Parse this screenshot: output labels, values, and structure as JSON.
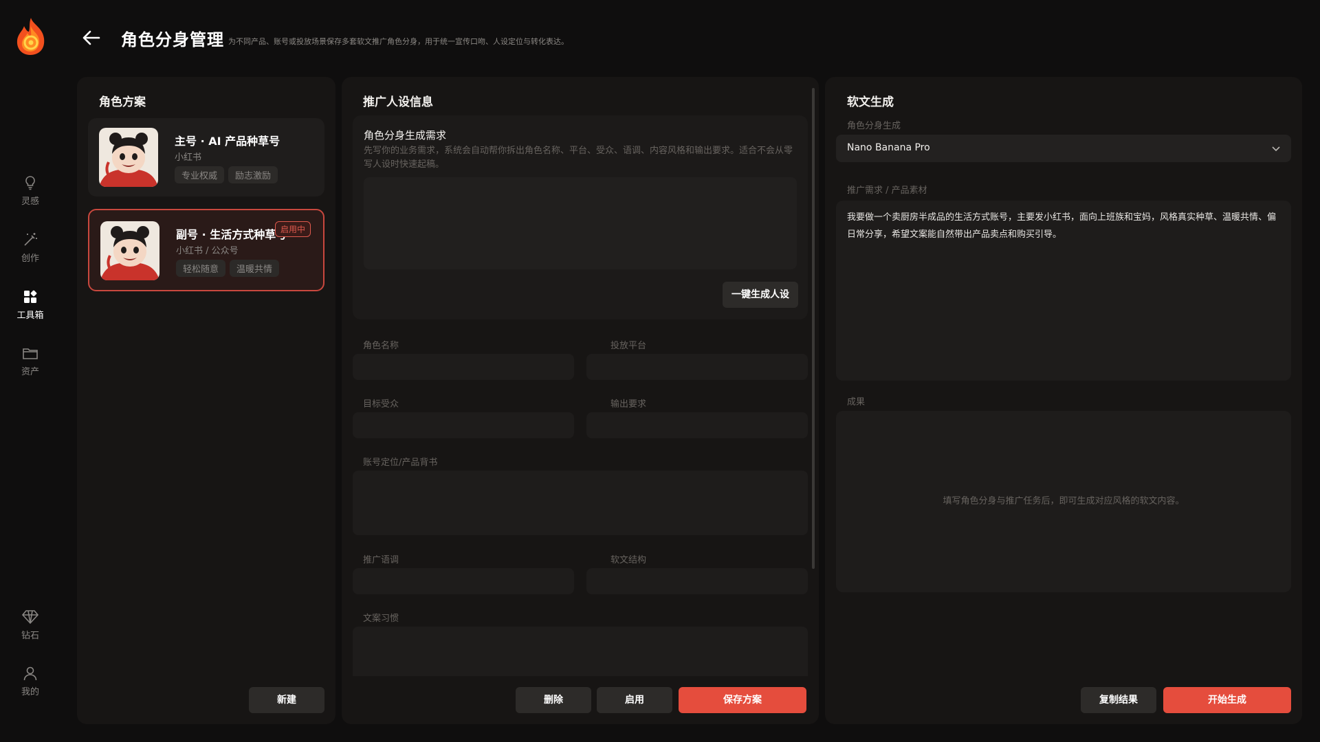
{
  "header": {
    "title": "角色分身管理",
    "subtitle": "为不同产品、账号或投放场景保存多套软文推广角色分身，用于统一宣传口吻、人设定位与转化表达。"
  },
  "sidebar": {
    "items": [
      {
        "label": "灵感",
        "icon": "lightbulb-icon",
        "active": false
      },
      {
        "label": "创作",
        "icon": "magic-wand-icon",
        "active": false
      },
      {
        "label": "工具箱",
        "icon": "toolbox-grid-icon",
        "active": true
      },
      {
        "label": "资产",
        "icon": "folder-icon",
        "active": false
      },
      {
        "label": "钻石",
        "icon": "diamond-icon",
        "active": false
      },
      {
        "label": "我的",
        "icon": "user-icon",
        "active": false
      }
    ]
  },
  "roles": {
    "title": "角色方案",
    "cards": [
      {
        "name": "主号 · AI 产品种草号",
        "platform": "小红书",
        "tags": [
          "专业权威",
          "励志激励"
        ],
        "active": false,
        "badge": ""
      },
      {
        "name": "副号 · 生活方式种草号",
        "platform": "小红书 / 公众号",
        "tags": [
          "轻松随意",
          "温暖共情"
        ],
        "active": true,
        "badge": "启用中"
      }
    ],
    "new_button": "新建"
  },
  "persona": {
    "title": "推广人设信息",
    "gen_title": "角色分身生成需求",
    "gen_desc": "先写你的业务需求，系统会自动帮你拆出角色名称、平台、受众、语调、内容风格和输出要求。适合不会从零写人设时快速起稿。",
    "gen_button": "一键生成人设",
    "fields": {
      "name": "角色名称",
      "platform": "投放平台",
      "audience": "目标受众",
      "output": "输出要求",
      "positioning": "账号定位/产品背书",
      "tone": "推广语调",
      "structure": "软文结构",
      "habit": "文案习惯"
    },
    "delete_button": "删除",
    "enable_button": "启用",
    "save_button": "保存方案"
  },
  "softgen": {
    "title": "软文生成",
    "model_label": "角色分身生成",
    "model_value": "Nano Banana Pro",
    "req_label": "推广需求 / 产品素材",
    "req_text": "我要做一个卖厨房半成品的生活方式账号，主要发小红书，面向上班族和宝妈，风格真实种草、温暖共情、偏日常分享，希望文案能自然带出产品卖点和购买引导。",
    "result_label": "成果",
    "result_placeholder": "填写角色分身与推广任务后，即可生成对应风格的软文内容。",
    "copy_button": "复制结果",
    "start_button": "开始生成"
  },
  "colors": {
    "background": "#0f0e0e",
    "panel": "#171514",
    "accent": "#e54d3d",
    "badge_border": "#e05a4e"
  }
}
